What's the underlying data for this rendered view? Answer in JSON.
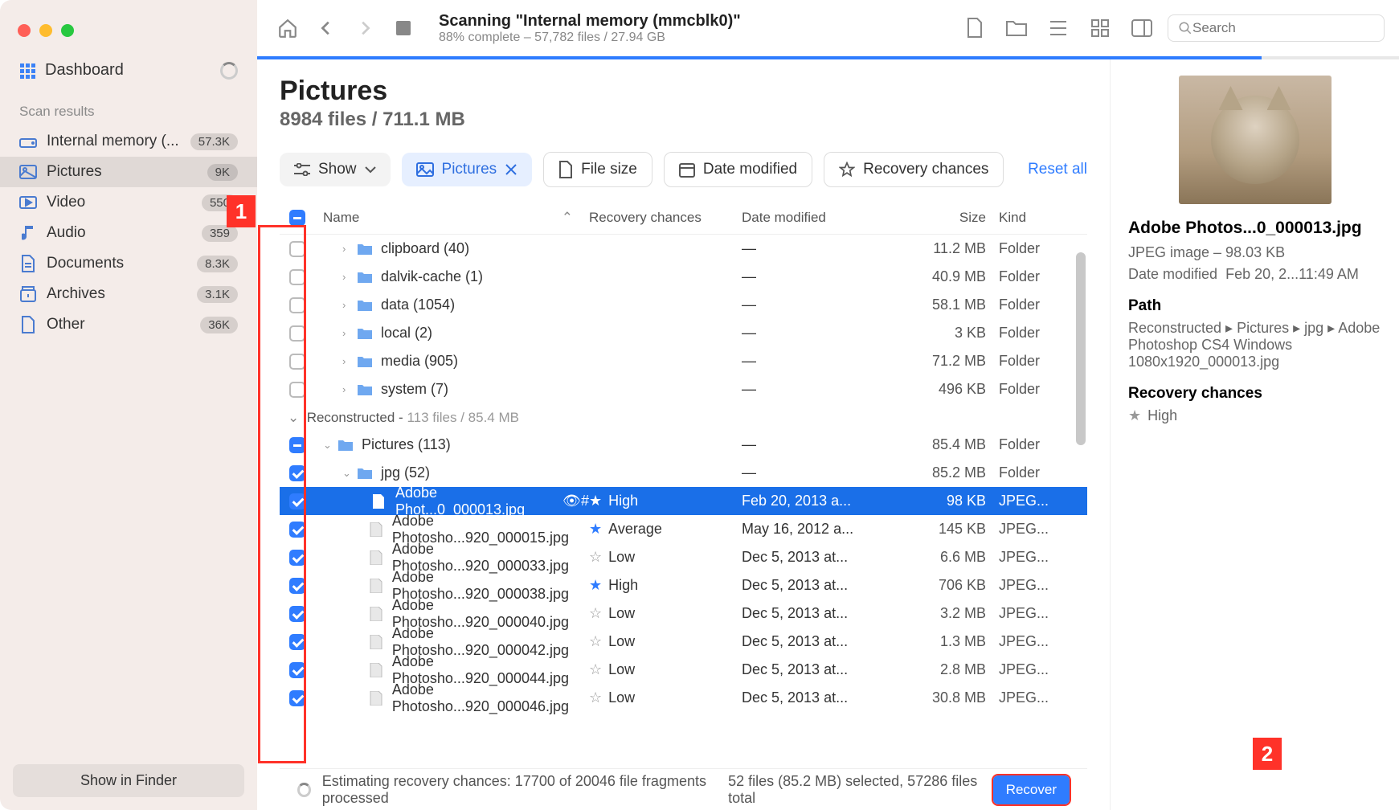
{
  "sidebar": {
    "dashboard": "Dashboard",
    "section": "Scan results",
    "items": [
      {
        "label": "Internal memory (...",
        "count": "57.3K",
        "icon": "drive"
      },
      {
        "label": "Pictures",
        "count": "9K",
        "icon": "picture",
        "active": true
      },
      {
        "label": "Video",
        "count": "550",
        "icon": "video"
      },
      {
        "label": "Audio",
        "count": "359",
        "icon": "audio"
      },
      {
        "label": "Documents",
        "count": "8.3K",
        "icon": "document"
      },
      {
        "label": "Archives",
        "count": "3.1K",
        "icon": "archive"
      },
      {
        "label": "Other",
        "count": "36K",
        "icon": "other"
      }
    ],
    "show_in_finder": "Show in Finder"
  },
  "toolbar": {
    "title": "Scanning \"Internal memory (mmcblk0)\"",
    "subtitle": "88% complete – 57,782 files / 27.94 GB",
    "search_placeholder": "Search",
    "progress_pct": 88
  },
  "page": {
    "title": "Pictures",
    "subtitle": "8984 files / 711.1 MB"
  },
  "filters": {
    "show": "Show",
    "pictures": "Pictures",
    "file_size": "File size",
    "date_modified": "Date modified",
    "recovery": "Recovery chances",
    "reset": "Reset all"
  },
  "columns": {
    "name": "Name",
    "recovery": "Recovery chances",
    "date": "Date modified",
    "size": "Size",
    "kind": "Kind"
  },
  "rows": [
    {
      "type": "folder",
      "indent": 1,
      "name": "clipboard (40)",
      "date": "—",
      "size": "11.2 MB",
      "kind": "Folder",
      "check": "none",
      "expand": true
    },
    {
      "type": "folder",
      "indent": 1,
      "name": "dalvik-cache (1)",
      "date": "—",
      "size": "40.9 MB",
      "kind": "Folder",
      "check": "none",
      "expand": true
    },
    {
      "type": "folder",
      "indent": 1,
      "name": "data (1054)",
      "date": "—",
      "size": "58.1 MB",
      "kind": "Folder",
      "check": "none",
      "expand": true
    },
    {
      "type": "folder",
      "indent": 1,
      "name": "local (2)",
      "date": "—",
      "size": "3 KB",
      "kind": "Folder",
      "check": "none",
      "expand": true
    },
    {
      "type": "folder",
      "indent": 1,
      "name": "media (905)",
      "date": "—",
      "size": "71.2 MB",
      "kind": "Folder",
      "check": "none",
      "expand": true
    },
    {
      "type": "folder",
      "indent": 1,
      "name": "system (7)",
      "date": "—",
      "size": "496 KB",
      "kind": "Folder",
      "check": "none",
      "expand": true
    },
    {
      "type": "group",
      "label": "Reconstructed -",
      "detail": "113 files / 85.4 MB"
    },
    {
      "type": "folder",
      "indent": 0,
      "name": "Pictures (113)",
      "date": "—",
      "size": "85.4 MB",
      "kind": "Folder",
      "check": "mixed",
      "expand": false,
      "open": true
    },
    {
      "type": "folder",
      "indent": 1,
      "name": "jpg (52)",
      "date": "—",
      "size": "85.2 MB",
      "kind": "Folder",
      "check": "checked",
      "expand": false,
      "open": true
    },
    {
      "type": "file",
      "indent": 2,
      "name": "Adobe Phot...0_000013.jpg",
      "recovery": "High",
      "date": "Feb 20, 2013 a...",
      "size": "98 KB",
      "kind": "JPEG...",
      "check": "checked",
      "selected": true,
      "star": true,
      "badges": true
    },
    {
      "type": "file",
      "indent": 2,
      "name": "Adobe Photosho...920_000015.jpg",
      "recovery": "Average",
      "date": "May 16, 2012 a...",
      "size": "145 KB",
      "kind": "JPEG...",
      "check": "checked",
      "star": true
    },
    {
      "type": "file",
      "indent": 2,
      "name": "Adobe Photosho...920_000033.jpg",
      "recovery": "Low",
      "date": "Dec 5, 2013 at...",
      "size": "6.6 MB",
      "kind": "JPEG...",
      "check": "checked"
    },
    {
      "type": "file",
      "indent": 2,
      "name": "Adobe Photosho...920_000038.jpg",
      "recovery": "High",
      "date": "Dec 5, 2013 at...",
      "size": "706 KB",
      "kind": "JPEG...",
      "check": "checked",
      "star": true
    },
    {
      "type": "file",
      "indent": 2,
      "name": "Adobe Photosho...920_000040.jpg",
      "recovery": "Low",
      "date": "Dec 5, 2013 at...",
      "size": "3.2 MB",
      "kind": "JPEG...",
      "check": "checked"
    },
    {
      "type": "file",
      "indent": 2,
      "name": "Adobe Photosho...920_000042.jpg",
      "recovery": "Low",
      "date": "Dec 5, 2013 at...",
      "size": "1.3 MB",
      "kind": "JPEG...",
      "check": "checked"
    },
    {
      "type": "file",
      "indent": 2,
      "name": "Adobe Photosho...920_000044.jpg",
      "recovery": "Low",
      "date": "Dec 5, 2013 at...",
      "size": "2.8 MB",
      "kind": "JPEG...",
      "check": "checked"
    },
    {
      "type": "file",
      "indent": 2,
      "name": "Adobe Photosho...920_000046.jpg",
      "recovery": "Low",
      "date": "Dec 5, 2013 at...",
      "size": "30.8 MB",
      "kind": "JPEG...",
      "check": "checked"
    }
  ],
  "footer": {
    "status1": "Estimating recovery chances: 17700 of 20046 file fragments processed",
    "status2": "52 files (85.2 MB) selected, 57286 files total",
    "recover": "Recover"
  },
  "preview": {
    "filename": "Adobe Photos...0_000013.jpg",
    "meta1": "JPEG image – 98.03 KB",
    "meta2a": "Date modified",
    "meta2b": "Feb 20, 2...11:49 AM",
    "path_label": "Path",
    "path": "Reconstructed ▸ Pictures ▸ jpg ▸ Adobe Photoshop CS4 Windows 1080x1920_000013.jpg",
    "rec_label": "Recovery chances",
    "rec_value": "High"
  },
  "annotations": {
    "a1": "1",
    "a2": "2"
  }
}
